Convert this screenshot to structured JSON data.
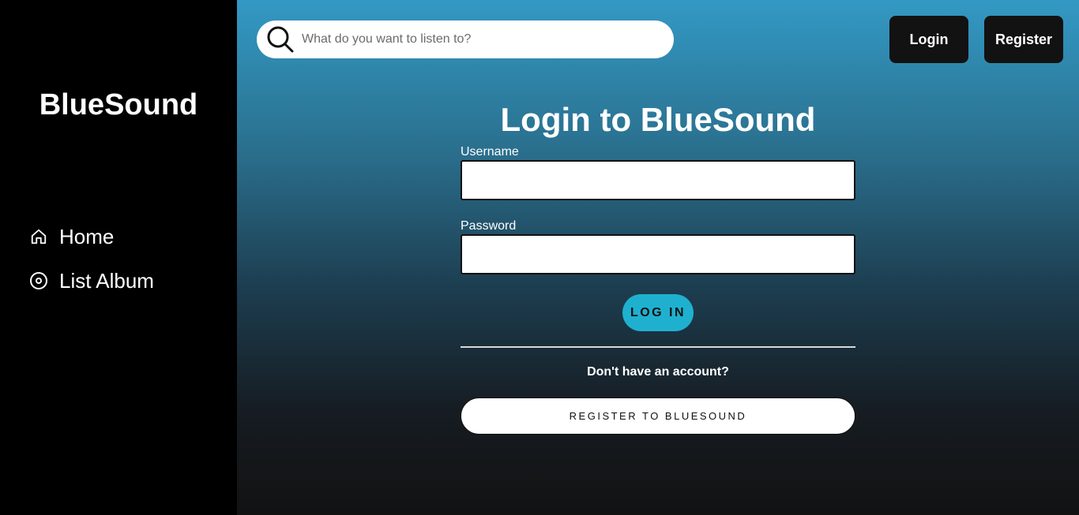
{
  "sidebar": {
    "brand": "BlueSound",
    "items": [
      {
        "label": "Home",
        "icon": "home-icon"
      },
      {
        "label": "List Album",
        "icon": "disc-icon"
      }
    ]
  },
  "header": {
    "search": {
      "placeholder": "What do you want to listen to?",
      "value": "",
      "icon": "search-icon"
    },
    "login_label": "Login",
    "register_label": "Register"
  },
  "login_form": {
    "title": "Login to BlueSound",
    "username_label": "Username",
    "username_value": "",
    "password_label": "Password",
    "password_value": "",
    "submit_label": "LOG IN",
    "no_account_text": "Don't have an account?",
    "register_label": "REGISTER TO BLUESOUND"
  },
  "colors": {
    "sidebar_bg": "#000000",
    "gradient_top": "#3399c4",
    "gradient_bottom": "#121212",
    "accent": "#1fb0d0",
    "dark_button": "#121212"
  }
}
